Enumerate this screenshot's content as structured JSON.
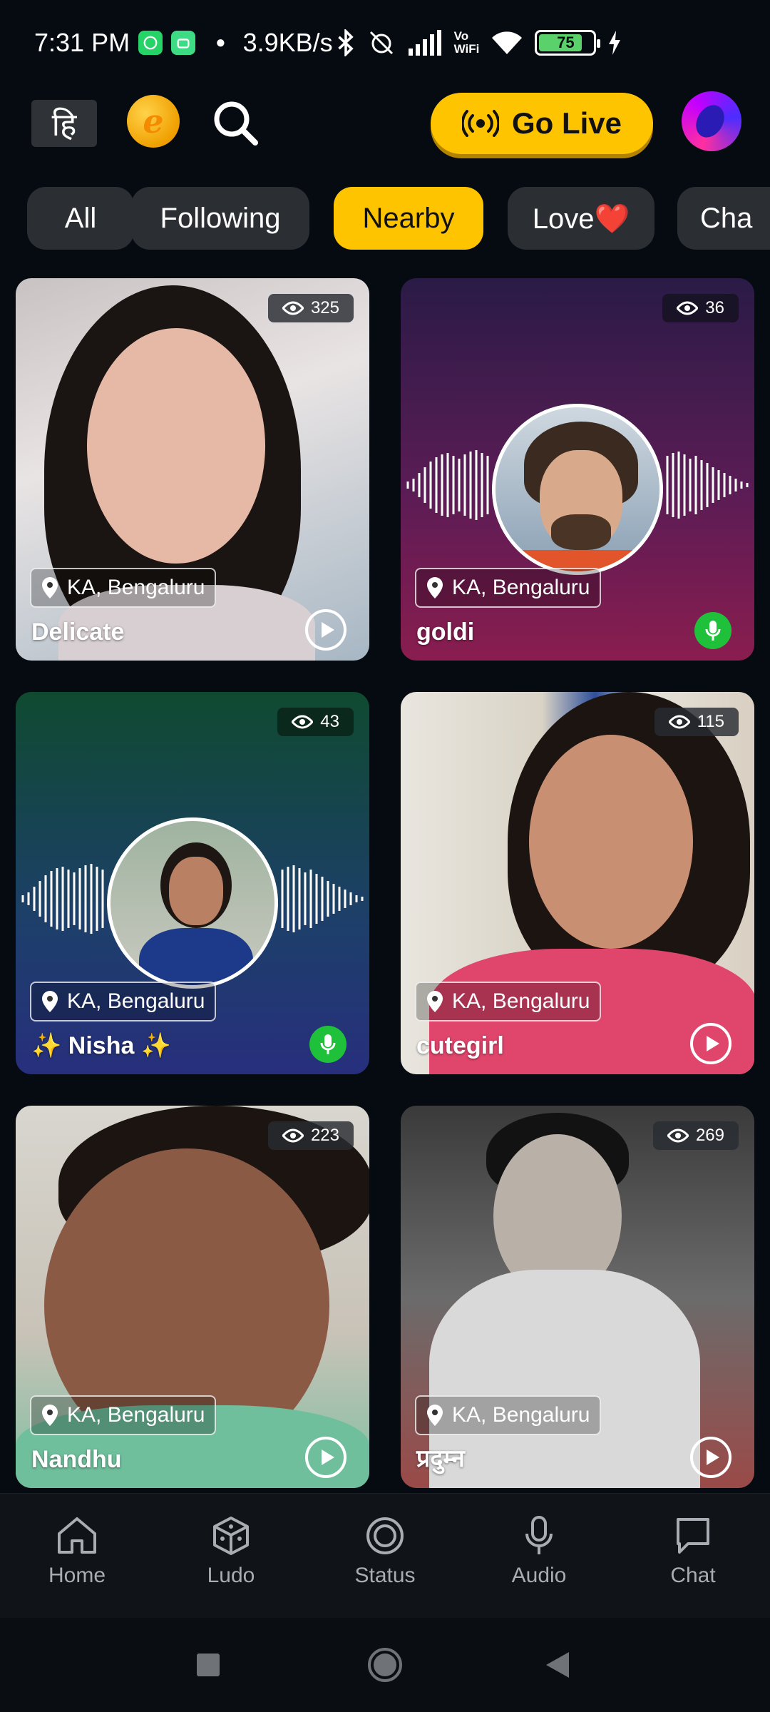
{
  "status_bar": {
    "time": "7:31 PM",
    "network_speed": "3.9KB/s",
    "volte": "Vo\nWiFi",
    "battery_level": "75"
  },
  "top_bar": {
    "language_label": "हि",
    "coin_label": "e",
    "go_live_label": "Go Live",
    "accent": "#ffc400"
  },
  "filters": [
    {
      "label": "All"
    },
    {
      "label": "Following"
    },
    {
      "label": "Nearby"
    },
    {
      "label": "Love❤️"
    },
    {
      "label": "Cha"
    }
  ],
  "selected_filter": "Nearby",
  "cards": [
    {
      "name": "Delicate",
      "location": "KA, Bengaluru",
      "views": "325",
      "type": "video"
    },
    {
      "name": "goldi",
      "location": "KA, Bengaluru",
      "views": "36",
      "type": "audio"
    },
    {
      "name": "✨ Nisha ✨",
      "location": "KA, Bengaluru",
      "views": "43",
      "type": "audio"
    },
    {
      "name": "cutegirl",
      "location": "KA, Bengaluru",
      "views": "115",
      "type": "video"
    },
    {
      "name": "Nandhu",
      "location": "KA, Bengaluru",
      "views": "223",
      "type": "video"
    },
    {
      "name": "प्रदुम्न",
      "location": "KA, Bengaluru",
      "views": "269",
      "type": "video"
    }
  ],
  "bottom_nav": [
    {
      "label": "Home",
      "icon": "home-icon"
    },
    {
      "label": "Ludo",
      "icon": "dice-icon"
    },
    {
      "label": "Status",
      "icon": "status-icon"
    },
    {
      "label": "Audio",
      "icon": "mic-icon"
    },
    {
      "label": "Chat",
      "icon": "chat-icon"
    }
  ],
  "colors": {
    "background": "#060b12",
    "chip": "#2b2e33",
    "mic_green": "#1fc13a"
  }
}
